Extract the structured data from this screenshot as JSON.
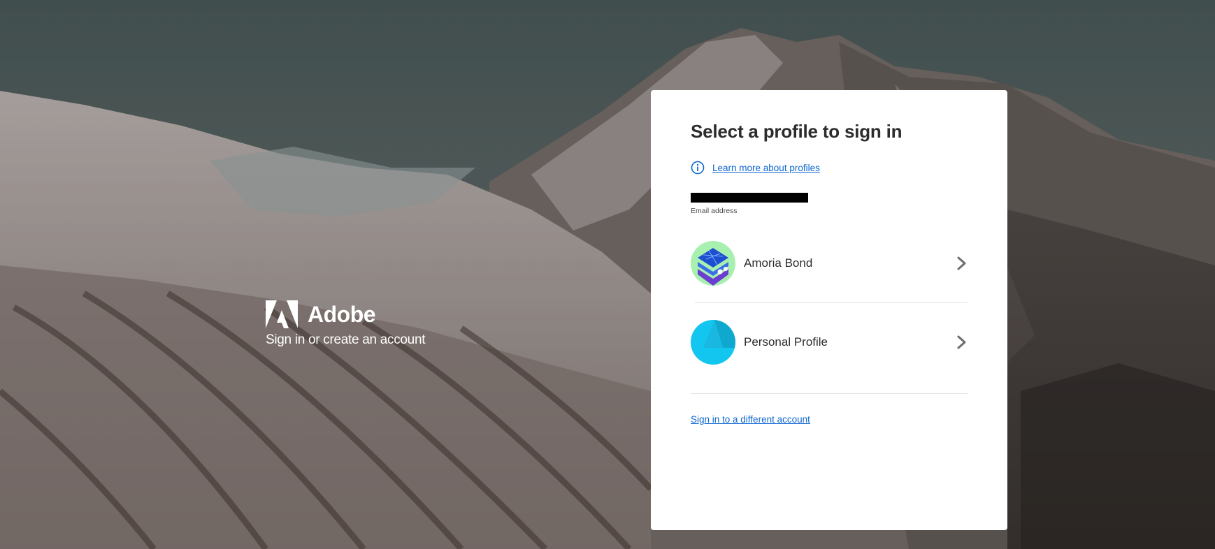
{
  "brand": {
    "name": "Adobe",
    "tagline": "Sign in or create an account"
  },
  "card": {
    "title": "Select a profile to sign in",
    "learn_more_link": "Learn more about profiles",
    "email_label": "Email address",
    "profiles": [
      {
        "name": "Amoria Bond"
      },
      {
        "name": "Personal Profile"
      }
    ],
    "different_account_link": "Sign in to a different account"
  },
  "colors": {
    "link": "#0d66d0",
    "card_bg": "#ffffff",
    "adobe_red": "#ffffff"
  },
  "icons": {
    "info": "info-icon",
    "chevron": "chevron-right-icon",
    "logo": "adobe-logo-icon"
  }
}
